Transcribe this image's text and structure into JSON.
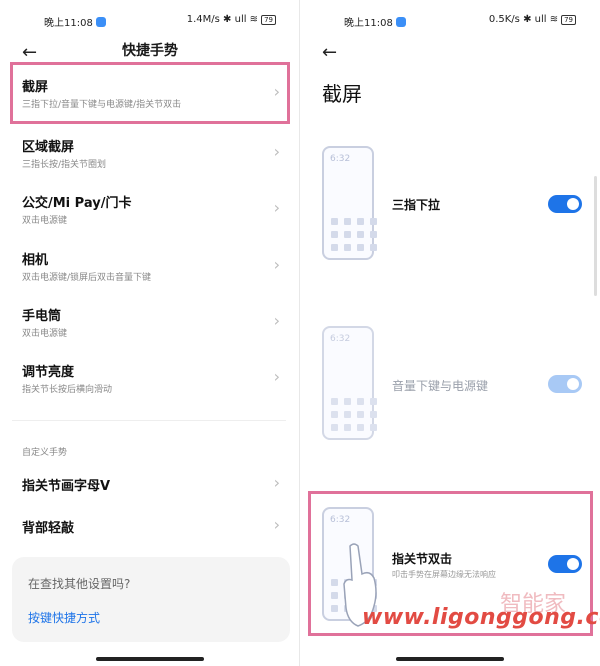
{
  "left": {
    "status": {
      "time": "晚上11:08",
      "right": "1.4M/s ✱ ull ≋",
      "battery": "79"
    },
    "title": "快捷手势",
    "items": [
      {
        "title": "截屏",
        "subtitle": "三指下拉/音量下键与电源键/指关节双击"
      },
      {
        "title": "区域截屏",
        "subtitle": "三指长按/指关节圈划"
      },
      {
        "title": "公交/Mi Pay/门卡",
        "subtitle": "双击电源键"
      },
      {
        "title": "相机",
        "subtitle": "双击电源键/锁屏后双击音量下键"
      },
      {
        "title": "手电筒",
        "subtitle": "双击电源键"
      },
      {
        "title": "调节亮度",
        "subtitle": "指关节长按后横向滑动"
      }
    ],
    "section_label": "自定义手势",
    "custom_items": [
      {
        "title": "指关节画字母V"
      },
      {
        "title": "背部轻敲"
      }
    ],
    "footer": {
      "question": "在查找其他设置吗?",
      "link": "按键快捷方式"
    }
  },
  "right": {
    "status": {
      "time": "晚上11:08",
      "right": "0.5K/s ✱ ull ≋",
      "battery": "79"
    },
    "title": "截屏",
    "options": [
      {
        "phone_time": "6:32",
        "label": "三指下拉",
        "subtitle": "",
        "toggle": "on"
      },
      {
        "phone_time": "6:32",
        "label": "音量下键与电源键",
        "subtitle": "",
        "toggle": "on-disabled"
      },
      {
        "phone_time": "6:32",
        "label": "指关节双击",
        "subtitle": "叩击手势在屏幕边缘无法响应",
        "toggle": "on"
      }
    ],
    "watermark": "www.ligonggong.com",
    "watermark_cn": "智能家"
  },
  "colors": {
    "accent": "#1e74e8",
    "highlight": "#e0719a"
  },
  "icons": {
    "back": "arrow-left-icon",
    "chevron": "chevron-right-icon"
  }
}
